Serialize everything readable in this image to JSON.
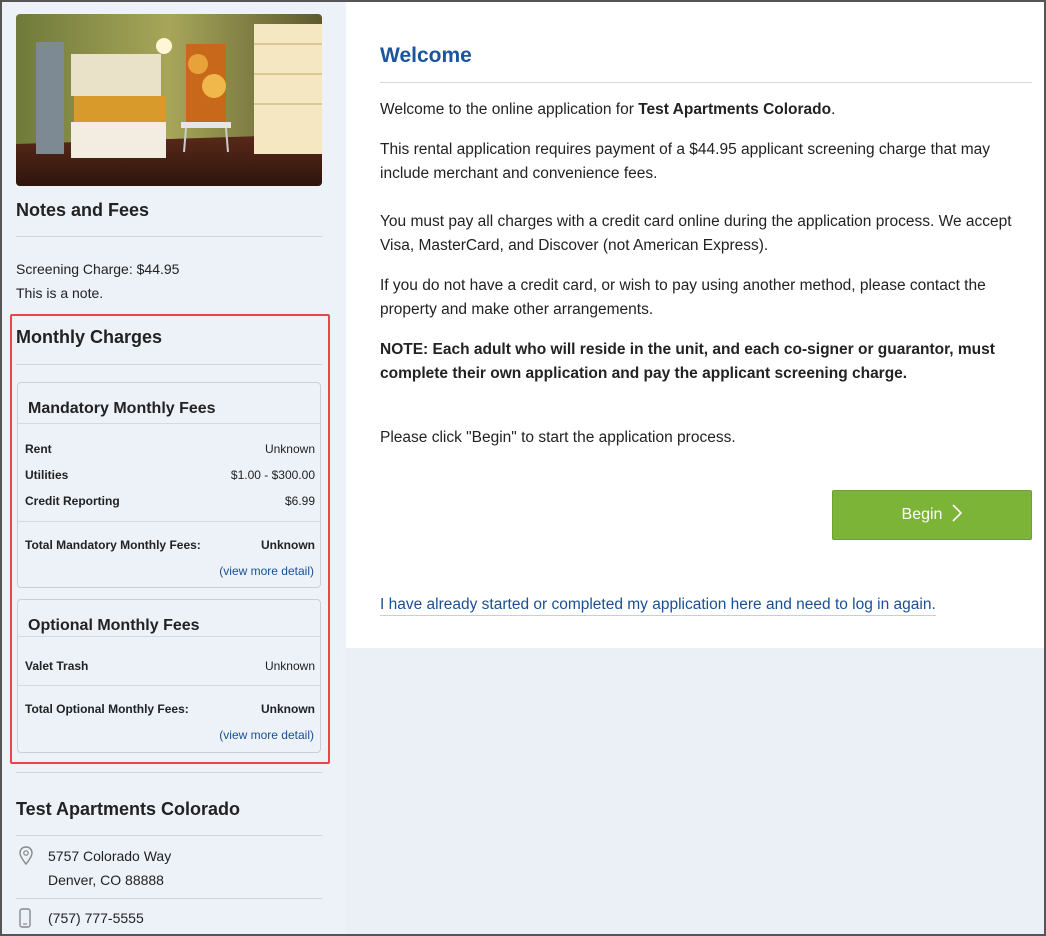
{
  "sidebar": {
    "notes_heading": "Notes and Fees",
    "screening_charge": "Screening Charge: $44.95",
    "note": "This is a note.",
    "monthly_heading": "Monthly Charges",
    "mandatory": {
      "title": "Mandatory Monthly Fees",
      "rows": [
        {
          "name": "Rent",
          "value": "Unknown"
        },
        {
          "name": "Utilities",
          "value": "$1.00 - $300.00"
        },
        {
          "name": "Credit Reporting",
          "value": "$6.99"
        }
      ],
      "total_label": "Total Mandatory Monthly Fees:",
      "total_value": "Unknown",
      "more_link": "(view more detail)"
    },
    "optional": {
      "title": "Optional Monthly Fees",
      "rows": [
        {
          "name": "Valet Trash",
          "value": "Unknown"
        }
      ],
      "total_label": "Total Optional Monthly Fees:",
      "total_value": "Unknown",
      "more_link": "(view more detail)"
    },
    "property": {
      "name": "Test Apartments Colorado",
      "address_line1": "5757 Colorado Way",
      "address_line2": "Denver, CO 88888",
      "phone": "(757) 777-5555"
    },
    "highlight_color": "#e4484d"
  },
  "main": {
    "title": "Welcome",
    "intro_prefix": "Welcome to the online application for ",
    "intro_property": "Test Apartments Colorado",
    "intro_suffix": ".",
    "para_fee": "This rental application requires payment of a $44.95 applicant screening charge that may include merchant and convenience fees.",
    "para_card": "You must pay all charges with a credit card online during the application process. We accept Visa, MasterCard, and Discover (not American Express).",
    "para_other": "If you do not have a credit card, or wish to pay using another method, please contact the property and make other arrangements.",
    "para_note": "NOTE: Each adult who will reside in the unit, and each co-signer or guarantor, must complete their own application and pay the applicant screening charge.",
    "para_begin": "Please click \"Begin\" to start the application process.",
    "begin_label": "Begin",
    "login_link": "I have already started or completed my application here and need to log in again."
  },
  "colors": {
    "accent_blue": "#1a56a0",
    "begin_green": "#7cb437",
    "link_blue": "#1a4f93"
  }
}
